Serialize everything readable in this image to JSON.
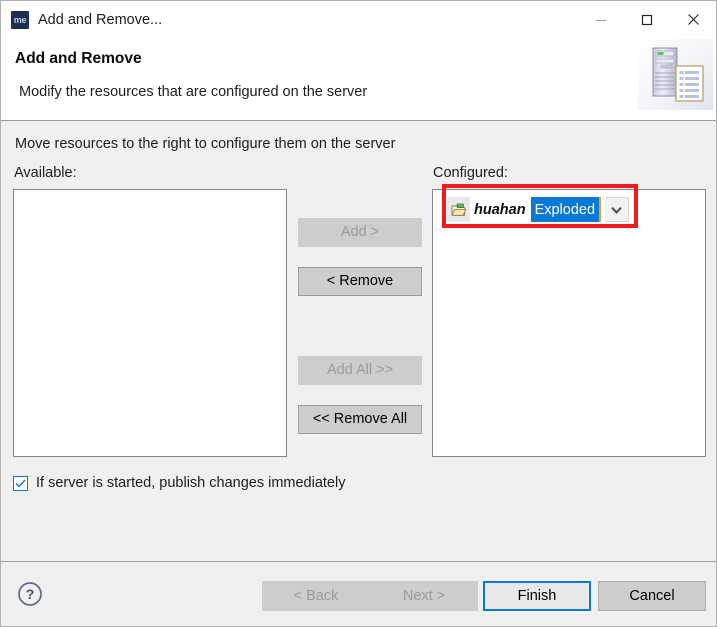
{
  "window": {
    "title": "Add and Remove...",
    "app_icon": "me",
    "controls": {
      "minimize": "minimize-icon",
      "maximize": "maximize-icon",
      "close": "close-icon"
    }
  },
  "header": {
    "title": "Add and Remove",
    "description": "Modify the resources that are configured on the server",
    "banner_icon": "server-and-document-icon"
  },
  "body": {
    "instruction": "Move resources to the right to configure them on the server",
    "available_label": "Available:",
    "configured_label": "Configured:",
    "available_items": [],
    "configured_items": [
      {
        "icon": "web-module-folder-icon",
        "name": "huahan",
        "deploy_mode": "Exploded",
        "dropdown_icon": "chevron-down-icon"
      }
    ]
  },
  "transfer_buttons": [
    {
      "label": "Add >",
      "enabled": false
    },
    {
      "label": "< Remove",
      "enabled": true
    },
    {
      "label": "Add All >>",
      "enabled": false
    },
    {
      "label": "<< Remove All",
      "enabled": true
    }
  ],
  "publish_option": {
    "label": "If server is started, publish changes immediately",
    "checked": true
  },
  "footer": {
    "help_icon": "help-question-icon",
    "back_label": "< Back",
    "next_label": "Next >",
    "finish_label": "Finish",
    "cancel_label": "Cancel"
  },
  "annotation": {
    "color": "#ee1c1c",
    "target": "configured-item-row"
  },
  "colors": {
    "selection_blue": "#0a78d7",
    "body_gray": "#f0f0f0",
    "button_gray": "#cdcdcd",
    "annotation_red": "#ee1c1c"
  }
}
